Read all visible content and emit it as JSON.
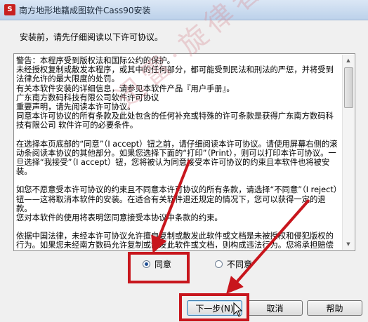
{
  "window": {
    "title": "南方地形地籍成图软件Cass90安装",
    "icon": "app-icon"
  },
  "intro": "安装前，请先仔细阅读以下许可协议。",
  "license": {
    "paragraphs": [
      "警告：本程序受到版权法和国际公约的保护。",
      "未经授权复制或散发本程序，或其中的任何部分，都可能受到民法和刑法的严惩，并将受到法律允许的最大限度的处罚。",
      "有关本软件安装的详细信息，请参见本软件产品『用户手册』。",
      "广东南方数码科技有限公司软件许可协议",
      "重要声明，请先阅读本许可协议。",
      "同意本许可协议的所有条款及此处包含的任何补充或特殊的许可条款是获得广东南方数码科技有限公司 软件许可的必要条件。",
      "",
      "在选择本页底部的“同意”（I accept）钮之前，请仔细阅读本许可协议。请使用屏幕右侧的滚动条阅读本协议的其他部分。如果您选择下面的“打印”（Print），则可以打印本许可协议。一旦选择“我接受”（I accept）钮，您将被认为同意接受本许可协议的约束且本软件也将被安装。",
      "",
      "如您不愿意受本许可协议的约束且不同意本许可协议的所有条款，请选择“不同意”（I reject）钮——这将取消本软件的安装。在适合有关软件退还规定的情况下，您可以获得一定的退款。",
      "您对本软件的使用将表明您同意接受本协议中条款的约束。",
      "",
      "依据中国法律，未经本许可协议允许擅自复制或散发此软件或文档是未被授权和侵犯版权的行为。如果您未经南方数码允许复制或散发此软件或文档，则构成违法行为。您将承担赔偿南方数码损失的法律责任，甚至承担刑事责任。"
    ]
  },
  "options": {
    "agree": "同意",
    "disagree": "不同意",
    "selected": "agree"
  },
  "buttons": {
    "next": "下一步(N)",
    "cancel": "取消",
    "help": "帮助"
  },
  "annotation": {
    "highlight_color": "#c8161d",
    "watermark": "迅雷·旋律者"
  }
}
